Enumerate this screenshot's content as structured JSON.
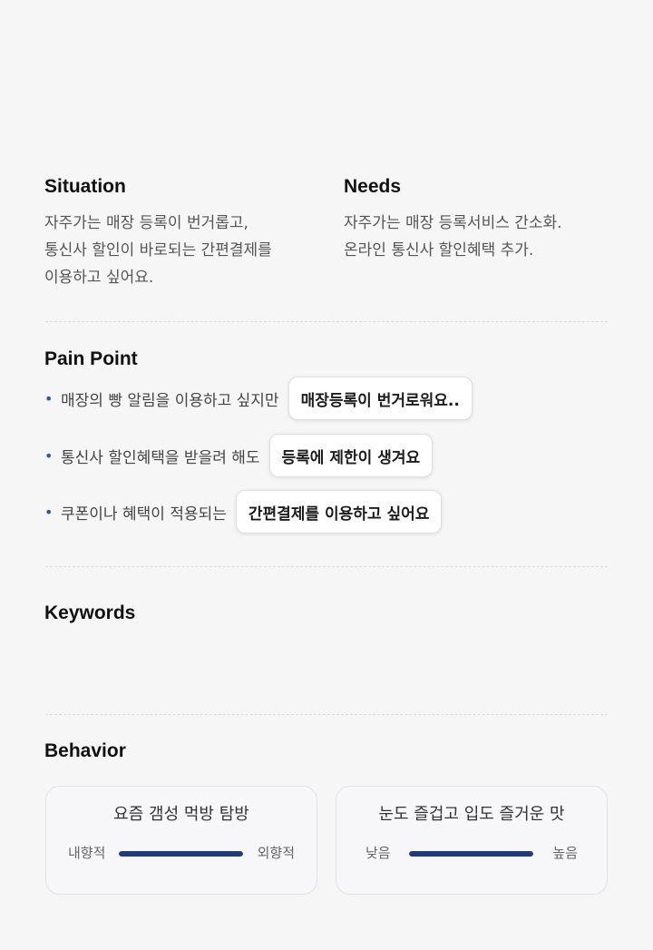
{
  "situation": {
    "title": "Situation",
    "lines": [
      "자주가는 매장 등록이 번거롭고,",
      "통신사 할인이 바로되는 간편결제를",
      "이용하고 싶어요."
    ]
  },
  "needs": {
    "title": "Needs",
    "lines": [
      "자주가는 매장 등록서비스 간소화.",
      "온라인 통신사 할인혜택 추가."
    ]
  },
  "pain_point": {
    "title": "Pain Point",
    "items": [
      {
        "text": "매장의 빵 알림을 이용하고 싶지만",
        "chip": "매장등록이 번거로워요.."
      },
      {
        "text": "통신사 할인혜택을 받을려 해도",
        "chip": "등록에 제한이 생겨요"
      },
      {
        "text": "쿠폰이나 혜택이 적용되는",
        "chip": "간편결제를 이용하고 싶어요"
      }
    ]
  },
  "keywords": {
    "title": "Keywords"
  },
  "behavior": {
    "title": "Behavior",
    "cards": [
      {
        "title": "요즘 갬성 먹방 탐방",
        "left": "내향적",
        "right": "외향적",
        "level": 1.0
      },
      {
        "title": "눈도 즐겁고 입도 즐거운 맛",
        "left": "낮음",
        "right": "높음",
        "level": 1.0
      }
    ]
  },
  "colors": {
    "accent": "#1f3a7d",
    "bullet": "#2a56b8",
    "background": "#f6f6f6"
  }
}
